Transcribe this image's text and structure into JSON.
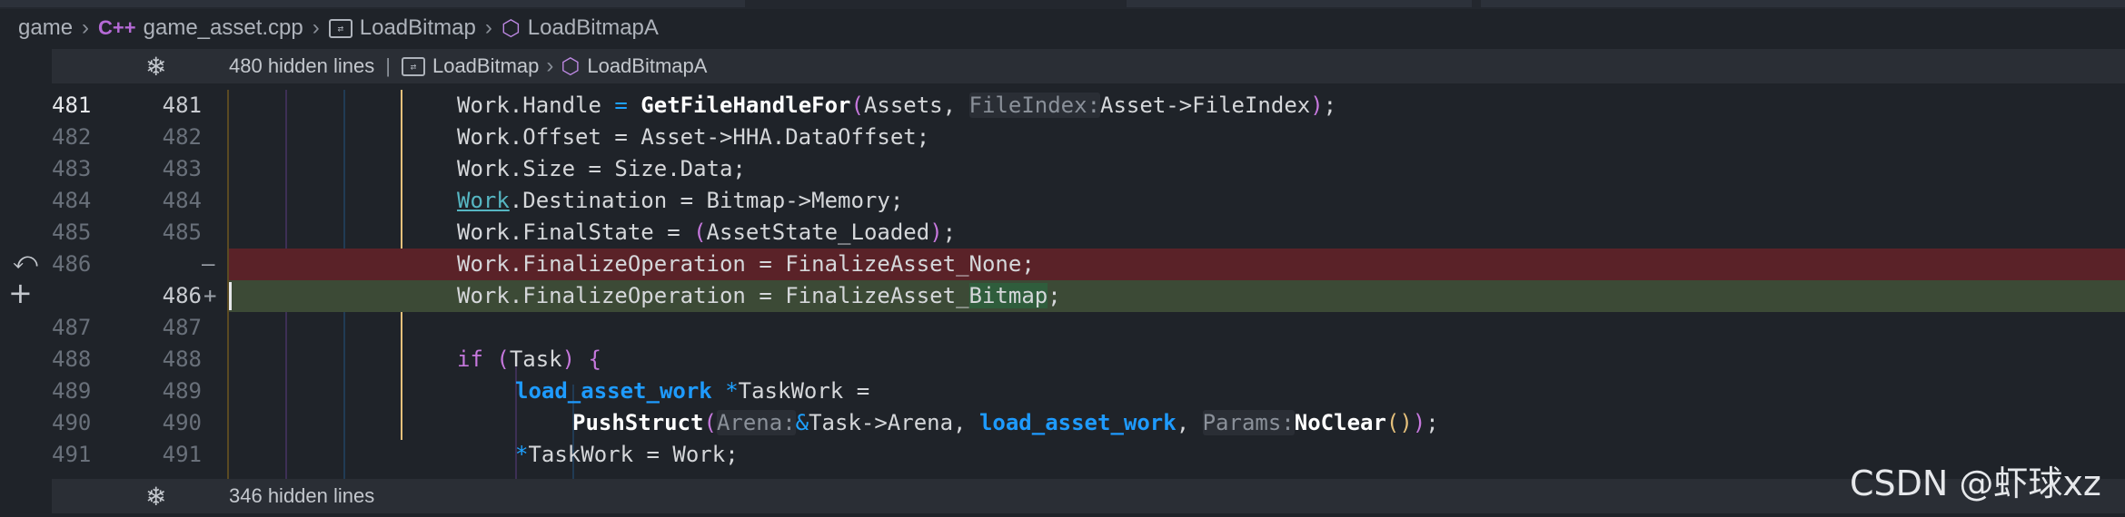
{
  "breadcrumb": {
    "items": [
      "game",
      "game_asset.cpp",
      "LoadBitmap",
      "LoadBitmapA"
    ],
    "cpp_icon": "C++"
  },
  "fold_top": {
    "label": "480 hidden lines",
    "items": [
      "LoadBitmap",
      "LoadBitmapA"
    ]
  },
  "fold_bottom": {
    "label": "346 hidden lines"
  },
  "lines": [
    {
      "a": "481",
      "b": "481",
      "marker": ""
    },
    {
      "a": "482",
      "b": "482",
      "marker": ""
    },
    {
      "a": "483",
      "b": "483",
      "marker": ""
    },
    {
      "a": "484",
      "b": "484",
      "marker": ""
    },
    {
      "a": "485",
      "b": "485",
      "marker": ""
    },
    {
      "a": "486",
      "b": "",
      "marker": "—"
    },
    {
      "a": "",
      "b": "486",
      "marker": "+"
    },
    {
      "a": "487",
      "b": "487",
      "marker": ""
    },
    {
      "a": "488",
      "b": "488",
      "marker": ""
    },
    {
      "a": "489",
      "b": "489",
      "marker": ""
    },
    {
      "a": "490",
      "b": "490",
      "marker": ""
    },
    {
      "a": "491",
      "b": "491",
      "marker": ""
    }
  ],
  "code": {
    "l481": {
      "t1": "Work.Handle ",
      "t2": "=",
      "t3": " ",
      "fn": "GetFileHandleFor",
      "p1": "(",
      "t4": "Assets, ",
      "hint": "FileIndex:",
      "t5": "Asset->FileIndex",
      "p2": ")",
      "t6": ";"
    },
    "l482": "Work.Offset = Asset->HHA.DataOffset;",
    "l483": "Work.Size = Size.Data;",
    "l484": {
      "ul": "Work",
      "rest": ".Destination = Bitmap->Memory;"
    },
    "l485": {
      "t1": "Work.FinalState = ",
      "p1": "(",
      "t2": "AssetState_Loaded",
      "p2": ")",
      "t3": ";"
    },
    "l486_old": "Work.FinalizeOperation = FinalizeAsset_None;",
    "l486_new": {
      "t1": "Work.FinalizeOperation = FinalizeAsset_",
      "w": "Bitmap",
      "t2": ";"
    },
    "l488": {
      "kw": "if",
      "t1": " ",
      "p1": "(",
      "t2": "Task",
      "p2": ")",
      "t3": " ",
      "b": "{"
    },
    "l489": {
      "ty": "load_asset_work",
      "t1": " ",
      "star": "*",
      "t2": "TaskWork ="
    },
    "l490": {
      "fn": "PushStruct",
      "p1": "(",
      "h1": "Arena:",
      "amp": "&",
      "t1": "Task->Arena, ",
      "ty": "load_asset_work",
      "t2": ", ",
      "h2": "Params:",
      "fn2": "NoClear",
      "p2": "()",
      "p3": ")",
      "t3": ";"
    },
    "l491": {
      "star": "*",
      "t1": "TaskWork = Work;"
    }
  },
  "watermark": "CSDN @虾球xz",
  "colors": {
    "background": "#1f2329",
    "deleted": "#5a2228",
    "added": "#3c4a36",
    "keyword": "#c678dd",
    "type": "#1e9bff",
    "guide_yellow": "#e5c07b",
    "guide_purple": "#8b5fbf",
    "guide_blue": "#2a6fa8"
  },
  "icons": [
    "cpp-icon",
    "method-icon",
    "cube-icon",
    "fold-icon",
    "revert-icon",
    "plus-icon"
  ]
}
